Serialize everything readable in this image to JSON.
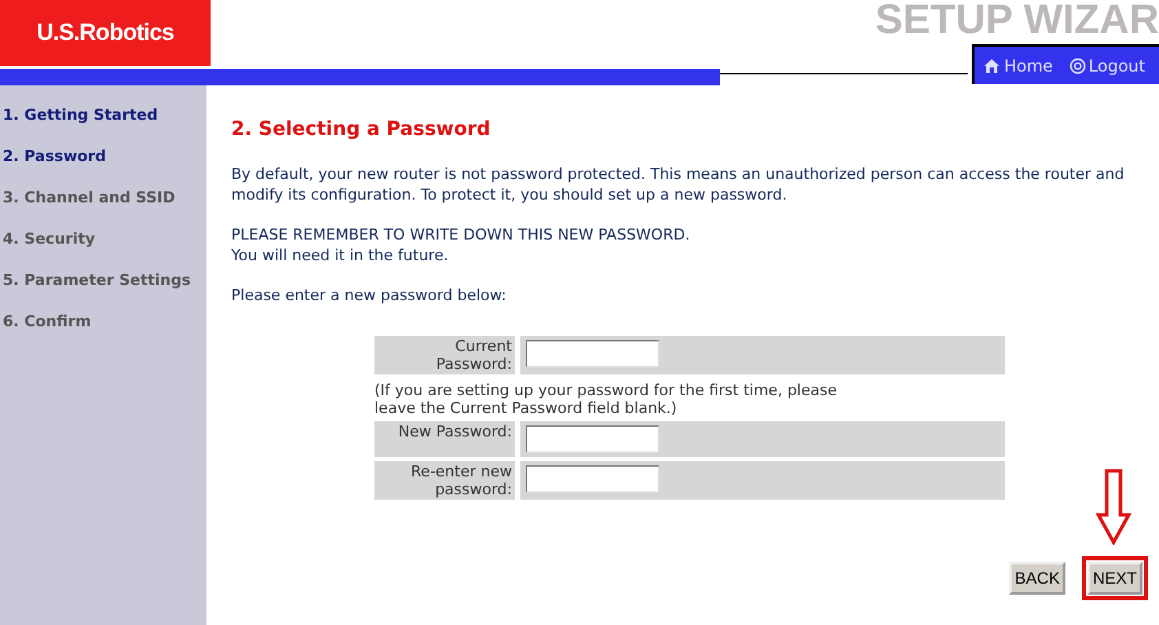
{
  "logo": "U.S.Robotics",
  "banner": "SETUP WIZAR",
  "nav": [
    {
      "kind": "home",
      "label": "Home"
    },
    {
      "kind": "logout",
      "label": "Logout"
    }
  ],
  "steps": [
    {
      "label": "1. Getting Started",
      "reached": true
    },
    {
      "label": "2. Password",
      "reached": true
    },
    {
      "label": "3. Channel and SSID",
      "reached": false
    },
    {
      "label": "4. Security",
      "reached": false
    },
    {
      "label": "5. Parameter Settings",
      "reached": false
    },
    {
      "label": "6. Confirm",
      "reached": false
    }
  ],
  "heading": "2. Selecting a Password",
  "paragraphs": [
    "By default, your new router is not password protected. This means an unauthorized person can access the router and modify its configuration. To protect it, you should set up a new password.",
    "PLEASE REMEMBER TO WRITE DOWN THIS NEW PASSWORD.\nYou will need it in the future.",
    "Please enter a new password below:"
  ],
  "form": [
    {
      "kind": "field",
      "label": "Current Password:"
    },
    {
      "kind": "note",
      "text": "(If you are setting up your password for the first time, please leave the Current Password field blank.)"
    },
    {
      "kind": "field",
      "label": "New Password:"
    },
    {
      "kind": "field",
      "label": "Re-enter new password:"
    }
  ],
  "buttons": [
    {
      "label": "BACK",
      "highlighted": false
    },
    {
      "label": "NEXT",
      "highlighted": true
    }
  ]
}
